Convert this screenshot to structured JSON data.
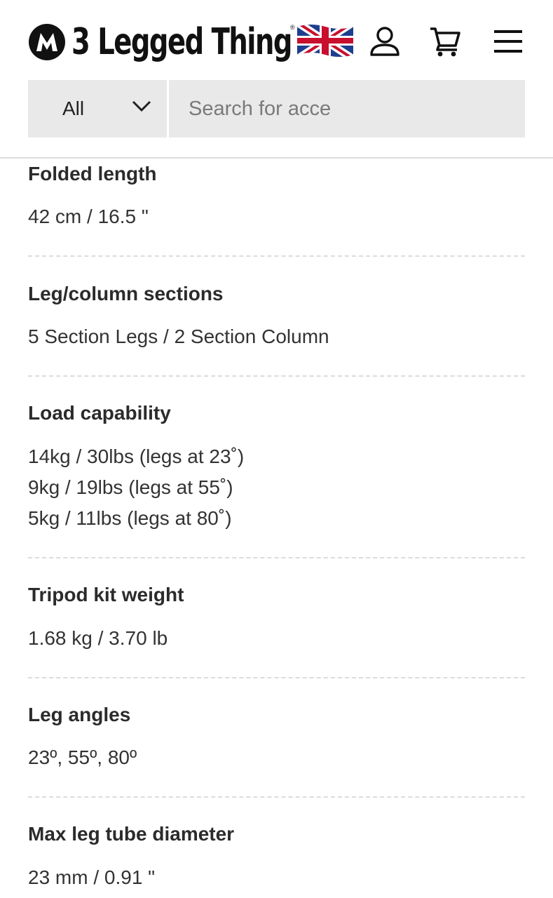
{
  "brand": {
    "logo_text": "3 Legged Thing",
    "registered_mark": "®",
    "flag_icon": "uk-flag-icon"
  },
  "header": {
    "icons": [
      "account-icon",
      "cart-icon",
      "menu-icon"
    ]
  },
  "search": {
    "category_selected": "All",
    "placeholder": "Search for acce"
  },
  "specs": [
    {
      "title": "Folded length",
      "values": [
        "42 cm / 16.5 \""
      ]
    },
    {
      "title": "Leg/column sections",
      "values": [
        "5 Section Legs / 2 Section Column"
      ]
    },
    {
      "title": "Load capability",
      "values": [
        "14kg / 30lbs (legs at 23˚)",
        "9kg / 19lbs (legs at 55˚)",
        "5kg / 11lbs (legs at 80˚)"
      ]
    },
    {
      "title": "Tripod kit weight",
      "values": [
        "1.68 kg / 3.70 lb"
      ]
    },
    {
      "title": "Leg angles",
      "values": [
        "23º, 55º, 80º"
      ]
    },
    {
      "title": "Max leg tube diameter",
      "values": [
        "23 mm / 0.91 \""
      ]
    }
  ],
  "colors": {
    "text": "#333333",
    "search_bg": "#e9e9e9",
    "separator": "#dcdcdc",
    "flag_blue": "#1d3f8f",
    "flag_red": "#c8102e"
  }
}
